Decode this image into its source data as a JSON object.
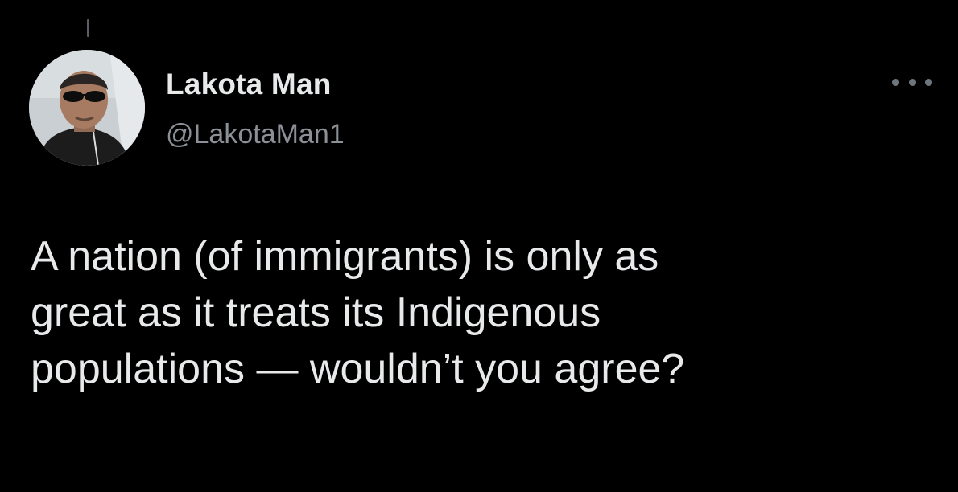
{
  "tweet": {
    "author": {
      "display_name": "Lakota Man",
      "handle": "@LakotaMan1",
      "avatar_icon": "profile-photo"
    },
    "more_icon": "more-options-icon",
    "text_lines": [
      "A nation (of immigrants) is only as",
      "great as it treats its Indigenous",
      "populations — wouldn’t you agree?"
    ]
  },
  "colors": {
    "background": "#000000",
    "primary_text": "#e7e9ea",
    "secondary_text": "#8b9096",
    "thread_line": "#5b5f64"
  }
}
